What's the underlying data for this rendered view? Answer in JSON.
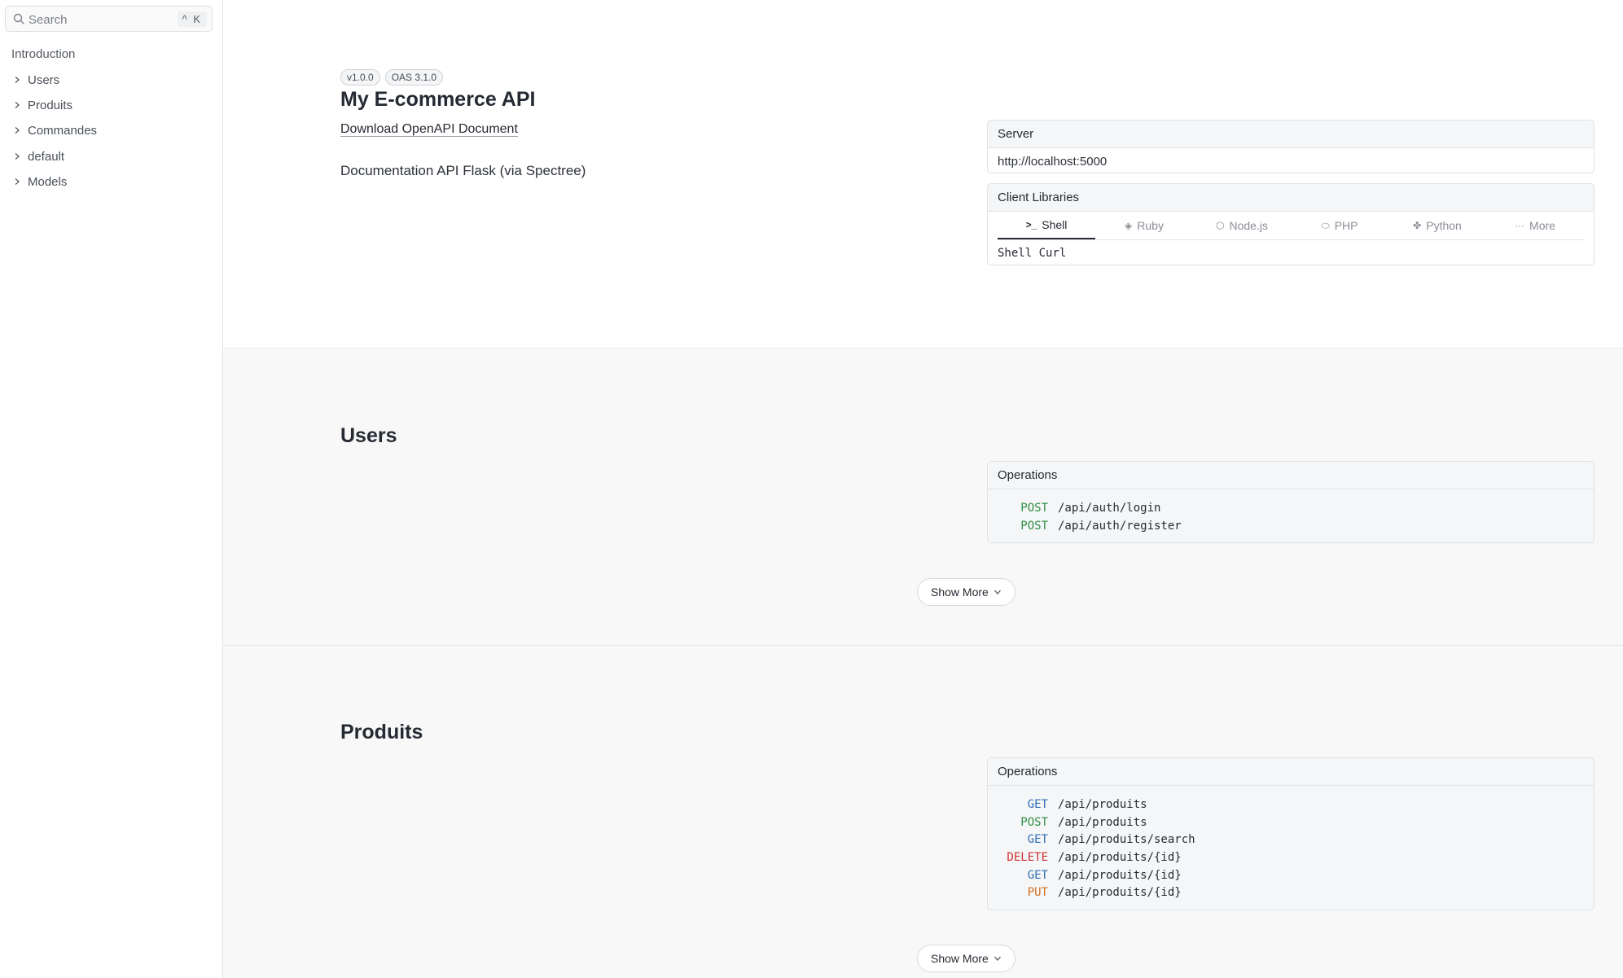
{
  "sidebar": {
    "search": {
      "placeholder": "Search",
      "shortcut": "^ K"
    },
    "intro_label": "Introduction",
    "items": [
      {
        "label": "Users"
      },
      {
        "label": "Produits"
      },
      {
        "label": "Commandes"
      },
      {
        "label": "default"
      },
      {
        "label": "Models"
      }
    ]
  },
  "intro": {
    "badges": [
      "v1.0.0",
      "OAS 3.1.0"
    ],
    "title": "My E-commerce API",
    "download_link": "Download OpenAPI Document",
    "description": "Documentation API Flask (via Spectree)"
  },
  "server": {
    "header": "Server",
    "url": "http://localhost:5000"
  },
  "client_libraries": {
    "header": "Client Libraries",
    "tabs": [
      {
        "label": "Shell",
        "icon": "terminal-icon",
        "active": true
      },
      {
        "label": "Ruby",
        "icon": "ruby-icon",
        "active": false
      },
      {
        "label": "Node.js",
        "icon": "nodejs-icon",
        "active": false
      },
      {
        "label": "PHP",
        "icon": "php-icon",
        "active": false
      },
      {
        "label": "Python",
        "icon": "python-icon",
        "active": false
      },
      {
        "label": "More",
        "icon": "more-icon",
        "active": false
      }
    ],
    "selected_client": "Shell Curl"
  },
  "sections": [
    {
      "title": "Users",
      "operations_header": "Operations",
      "operations": [
        {
          "method": "POST",
          "path": "/api/auth/login"
        },
        {
          "method": "POST",
          "path": "/api/auth/register"
        }
      ],
      "show_more": "Show More"
    },
    {
      "title": "Produits",
      "operations_header": "Operations",
      "operations": [
        {
          "method": "GET",
          "path": "/api/produits"
        },
        {
          "method": "POST",
          "path": "/api/produits"
        },
        {
          "method": "GET",
          "path": "/api/produits/search"
        },
        {
          "method": "DELETE",
          "path": "/api/produits/{id}"
        },
        {
          "method": "GET",
          "path": "/api/produits/{id}"
        },
        {
          "method": "PUT",
          "path": "/api/produits/{id}"
        }
      ],
      "show_more": "Show More"
    }
  ],
  "colors": {
    "post": "#2f8f46",
    "get": "#2f6db5",
    "delete": "#cf2f2f",
    "put": "#d0711f"
  }
}
